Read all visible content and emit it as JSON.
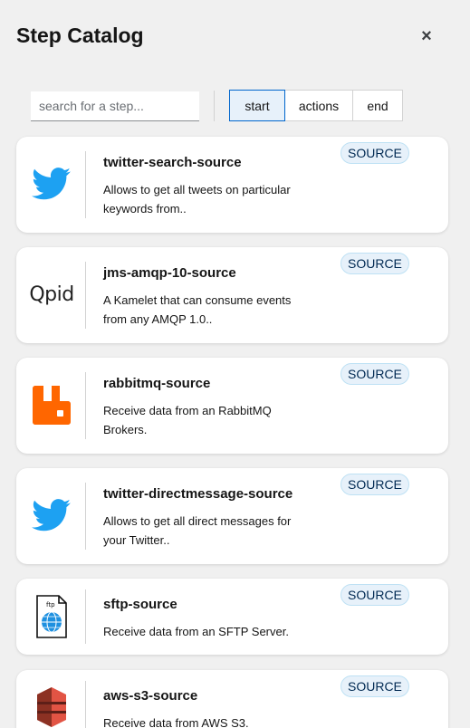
{
  "header": {
    "title": "Step Catalog",
    "close_label": "×"
  },
  "search": {
    "placeholder": "search for a step..."
  },
  "toggles": [
    {
      "label": "start",
      "selected": true
    },
    {
      "label": "actions",
      "selected": false
    },
    {
      "label": "end",
      "selected": false
    }
  ],
  "steps": [
    {
      "name": "twitter-search-source",
      "desc_line1": "Allows to get all tweets on particular",
      "desc_line2": "keywords from..",
      "badge": "SOURCE",
      "icon": "twitter-icon"
    },
    {
      "name": "jms-amqp-10-source",
      "desc_line1": "A Kamelet that can consume events",
      "desc_line2": "from any AMQP 1.0..",
      "badge": "SOURCE",
      "icon": "qpid-logo",
      "logo_text": "Qpid"
    },
    {
      "name": "rabbitmq-source",
      "desc_line1": "Receive data from an RabbitMQ",
      "desc_line2": "Brokers.",
      "badge": "SOURCE",
      "icon": "rabbitmq-icon"
    },
    {
      "name": "twitter-directmessage-source",
      "desc_line1": "Allows to get all direct messages for",
      "desc_line2": "your Twitter..",
      "badge": "SOURCE",
      "icon": "twitter-icon"
    },
    {
      "name": "sftp-source",
      "desc_line1": "Receive data from an SFTP Server.",
      "desc_line2": "",
      "badge": "SOURCE",
      "icon": "sftp-file-icon",
      "logo_text": "ftp"
    },
    {
      "name": "aws-s3-source",
      "desc_line1": "Receive data from AWS S3.",
      "desc_line2": "",
      "badge": "SOURCE",
      "icon": "aws-s3-icon"
    }
  ],
  "colors": {
    "twitter": "#1da1f2",
    "rabbitmq": "#ff6600",
    "aws_s3": "#e25444",
    "selected_toggle_bg": "#e7f1fa",
    "badge_bg": "#e7f1fa"
  }
}
